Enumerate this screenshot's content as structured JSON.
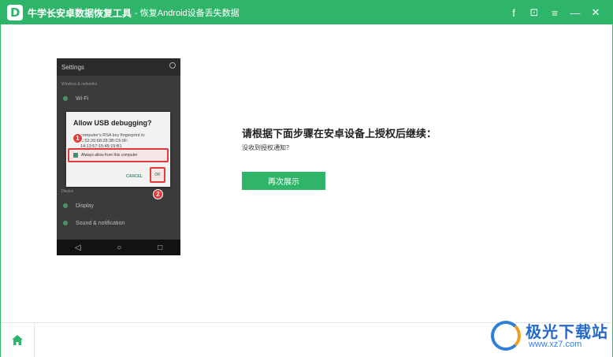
{
  "titlebar": {
    "app_title": "牛学长安卓数据恢复工具",
    "subtitle": "- 恢复Android设备丢失数据",
    "controls": [
      {
        "name": "facebook-icon",
        "glyph": "f"
      },
      {
        "name": "feedback-icon",
        "glyph": "⊡"
      },
      {
        "name": "menu-icon",
        "glyph": "≡"
      },
      {
        "name": "minimize-icon",
        "glyph": "—"
      },
      {
        "name": "close-icon",
        "glyph": "✕"
      }
    ]
  },
  "phone": {
    "status_title": "Settings",
    "section1": "Wireless & networks",
    "row_wifi": "Wi-Fi",
    "section2": "Device",
    "row_display": "Display",
    "row_sound": "Sound & notification",
    "nav_back": "◁",
    "nav_home": "○",
    "nav_recent": "□"
  },
  "dialog": {
    "title": "Allow USB debugging?",
    "body": "computer's RSA key fingerprint is: C:52:20:68:28:3B:C6:0F: 14:13:57:15:45:19:B1",
    "checkbox_label": "Always allow from this computer",
    "cancel": "CANCEL",
    "ok": "OK",
    "badge1": "1",
    "badge2": "2"
  },
  "instructions": {
    "title": "请根据下面步骤在安卓设备上授权后继续：",
    "subtitle": "没收到授权通知？",
    "button": "再次展示"
  },
  "watermark": {
    "text": "极光下载站",
    "url": "www.xz7.com"
  },
  "colors": {
    "brand_green": "#2fb56a",
    "highlight_red": "#e23b3b"
  }
}
